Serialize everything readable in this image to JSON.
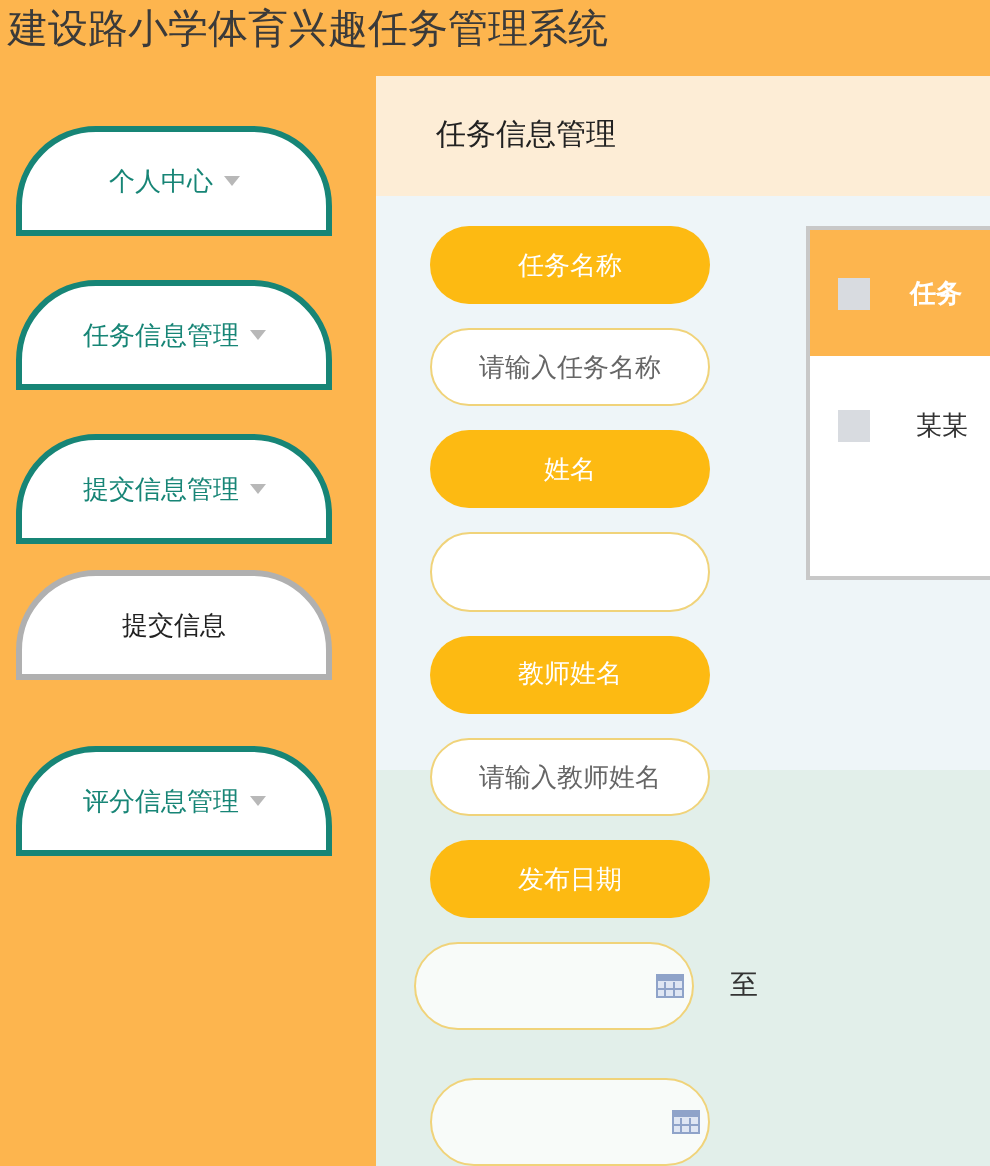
{
  "header": {
    "title": "建设路小学体育兴趣任务管理系统"
  },
  "sidebar": {
    "items": [
      {
        "label": "个人中心",
        "has_menu": true
      },
      {
        "label": "任务信息管理",
        "has_menu": true
      },
      {
        "label": "提交信息管理",
        "has_menu": true,
        "children": [
          {
            "label": "提交信息"
          }
        ]
      },
      {
        "label": "评分信息管理",
        "has_menu": true
      }
    ]
  },
  "page": {
    "title": "任务信息管理"
  },
  "search_form": {
    "fields": [
      {
        "kind": "text",
        "label": "任务名称",
        "placeholder": "请输入任务名称"
      },
      {
        "kind": "text",
        "label": "姓名"
      },
      {
        "kind": "text",
        "label": "教师姓名",
        "placeholder": "请输入教师姓名"
      },
      {
        "kind": "date_range",
        "label": "发布日期",
        "separator": "至"
      }
    ]
  },
  "table": {
    "header_checked": false,
    "columns": [
      "任务"
    ],
    "rows": [
      {
        "checked": false,
        "cells": [
          "某某"
        ]
      }
    ]
  }
}
